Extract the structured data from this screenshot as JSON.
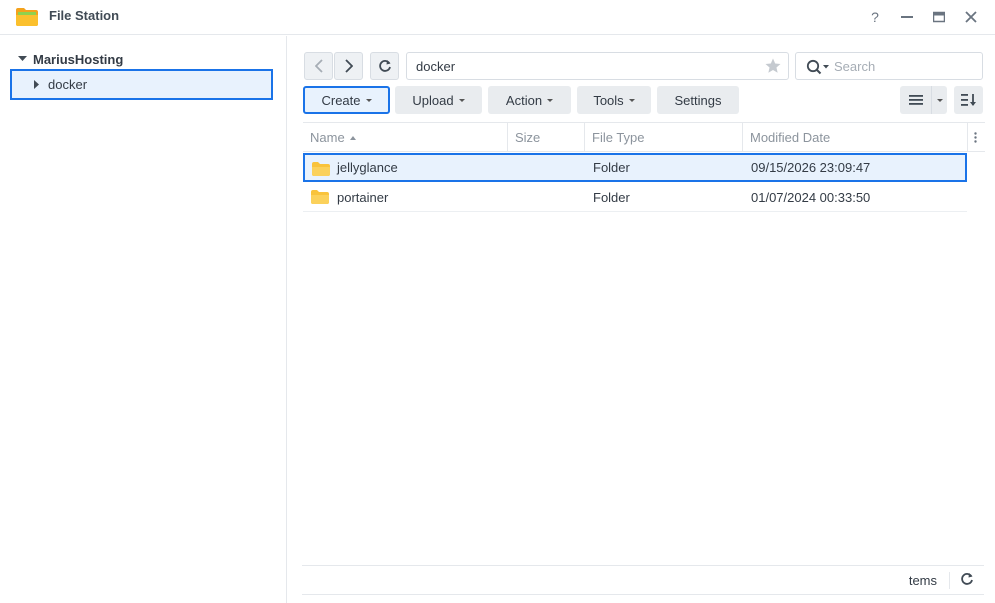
{
  "window": {
    "title": "File Station",
    "help_icon": "help-icon",
    "minimize_icon": "minimize-icon",
    "maximize_icon": "maximize-icon",
    "close_icon": "close-icon"
  },
  "sidebar": {
    "root_label": "MariusHosting",
    "items": [
      {
        "label": "docker",
        "selected": true
      }
    ]
  },
  "toolbar": {
    "path": "docker",
    "search_placeholder": "Search",
    "buttons": {
      "create": "Create",
      "upload": "Upload",
      "action": "Action",
      "tools": "Tools",
      "settings": "Settings"
    }
  },
  "table": {
    "columns": {
      "name": "Name",
      "size": "Size",
      "type": "File Type",
      "date": "Modified Date"
    },
    "rows": [
      {
        "name": "jellyglance",
        "size": "",
        "type": "Folder",
        "date": "09/15/2026 23:09:47",
        "selected": true
      },
      {
        "name": "portainer",
        "size": "",
        "type": "Folder",
        "date": "01/07/2024 00:33:50",
        "selected": false
      }
    ]
  },
  "footer": {
    "status": "tems"
  },
  "colors": {
    "accent": "#1a73e8",
    "selection_bg": "#e8f2fd",
    "folder": "#f9c33c"
  }
}
